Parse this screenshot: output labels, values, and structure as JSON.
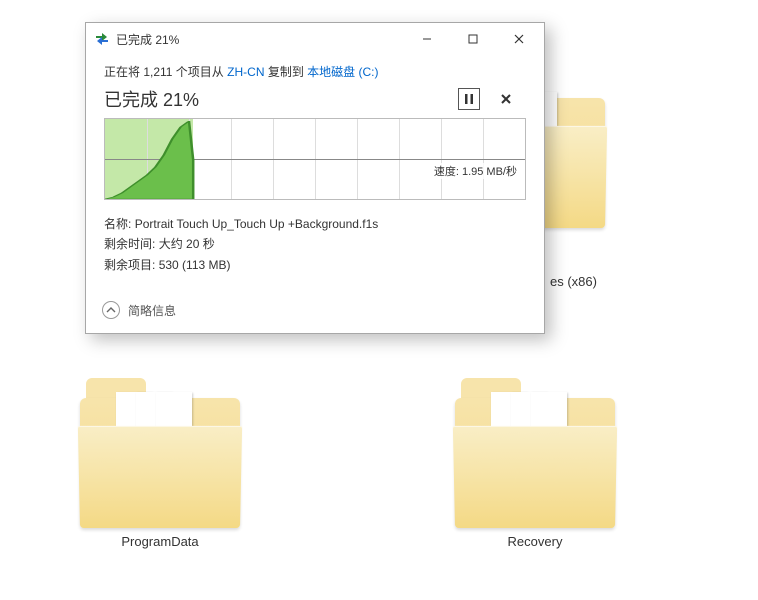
{
  "folders": {
    "partial_label_right": "es (x86)",
    "bottom_left": "ProgramData",
    "bottom_right": "Recovery"
  },
  "dialog": {
    "title": "已完成 21%",
    "copy_prefix": "正在将 1,211 个项目从 ",
    "copy_src": "ZH-CN",
    "copy_mid": " 复制到 ",
    "copy_dest": "本地磁盘 (C:)",
    "progress_big_prefix": "已完成 ",
    "progress_big_percent": "21%",
    "speed_label": "速度:",
    "speed_value": "1.95 MB/秒",
    "details": {
      "name_label": "名称:",
      "name_value": "Portrait Touch Up_Touch Up +Background.f1s",
      "time_label": "剩余时间:",
      "time_value": "大约 20 秒",
      "items_label": "剩余项目:",
      "items_value": "530 (113 MB)"
    },
    "footer_label": "简略信息",
    "progress_percent": 21
  },
  "chart_data": {
    "type": "area",
    "title": "",
    "xlabel": "",
    "ylabel": "速度",
    "ylim": [
      0,
      4
    ],
    "x": [
      0,
      2,
      4,
      6,
      8,
      10,
      12,
      14,
      16,
      18,
      20,
      21
    ],
    "values": [
      0,
      0.1,
      0.3,
      0.6,
      0.9,
      1.2,
      1.6,
      2.2,
      3.0,
      3.6,
      3.9,
      1.95
    ],
    "current_speed": 1.95,
    "unit": "MB/秒",
    "progress_percent": 21
  }
}
